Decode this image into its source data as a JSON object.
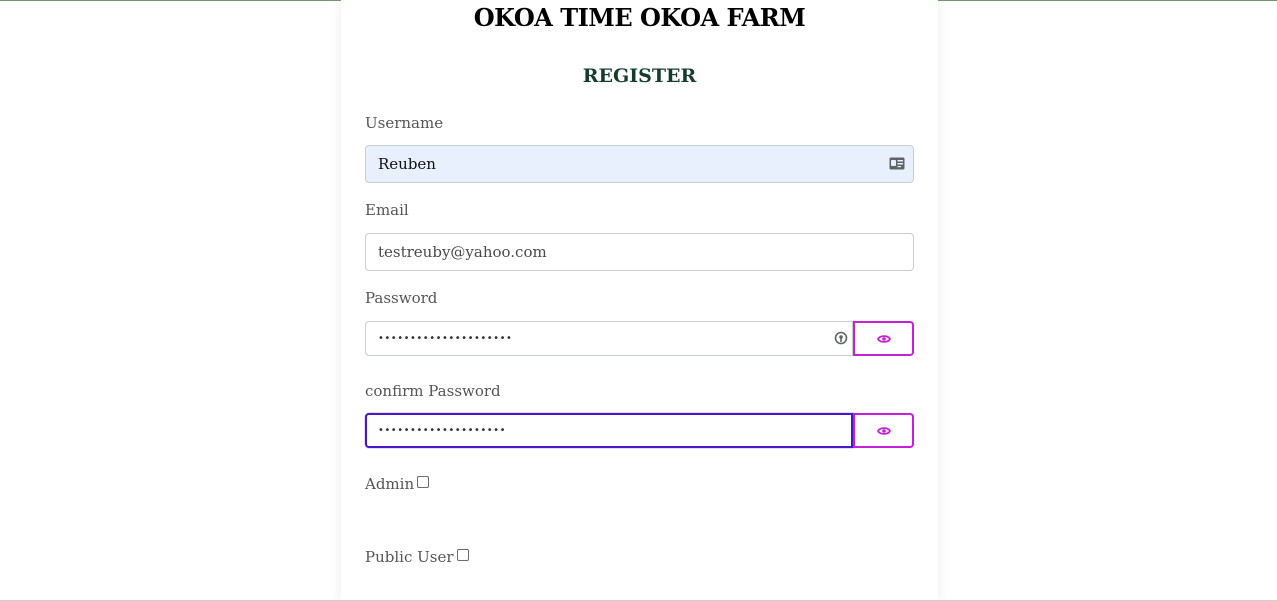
{
  "app": {
    "title": "OKOA TIME OKOA FARM"
  },
  "form": {
    "title": "REGISTER",
    "username": {
      "label": "Username",
      "value": "Reuben",
      "icon": "contact-card-icon"
    },
    "email": {
      "label": "Email",
      "value": "testreuby@yahoo.com"
    },
    "password": {
      "label": "Password",
      "masked_value": "•••••••••••••••••••••",
      "key_icon": "password-key-icon",
      "toggle_icon": "eye-icon"
    },
    "confirm_password": {
      "label": "confirm Password",
      "masked_value": "••••••••••••••••••••",
      "toggle_icon": "eye-icon"
    },
    "admin": {
      "label": "Admin",
      "checked": false
    },
    "public_user": {
      "label": "Public User",
      "checked": false
    }
  },
  "colors": {
    "title": "#000000",
    "form_title": "#163d2b",
    "eye_button_border": "#c61fd8",
    "focus_border": "#4a16c9",
    "autofill_bg": "#e8f0fe"
  }
}
